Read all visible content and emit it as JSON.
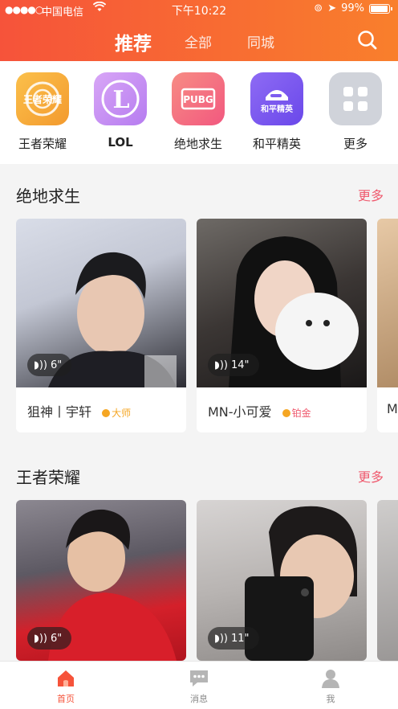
{
  "status": {
    "carrier": "中国电信",
    "time": "下午10:22",
    "battery": "99%"
  },
  "header": {
    "tab_active": "推荐",
    "tab_all": "全部",
    "tab_city": "同城"
  },
  "categories": [
    {
      "label": "王者荣耀",
      "icon_text": "王者荣耀",
      "icon": "honor-of-kings-icon",
      "color": "#f7a335"
    },
    {
      "label": "LOL",
      "icon_text": "L",
      "icon": "lol-icon",
      "color": "#c58cf0"
    },
    {
      "label": "绝地求生",
      "icon_text": "PUBG",
      "icon": "pubg-icon",
      "color": "#f36a8a"
    },
    {
      "label": "和平精英",
      "icon_text": "和平精英",
      "icon": "peace-elite-icon",
      "color": "#7d5cf0"
    },
    {
      "label": "更多",
      "icon_text": "",
      "icon": "more-grid-icon",
      "color": "#c9ccd3"
    }
  ],
  "sections": [
    {
      "title": "绝地求生",
      "more": "更多",
      "cards": [
        {
          "duration": "6\"",
          "name": "狙神丨宇轩",
          "rank": "大师"
        },
        {
          "duration": "14\"",
          "name": "MN-小可爱",
          "rank": "铂金"
        },
        {
          "duration": "",
          "name": "M",
          "rank": ""
        }
      ]
    },
    {
      "title": "王者荣耀",
      "more": "更多",
      "cards": [
        {
          "duration": "6\"",
          "name": "",
          "rank": ""
        },
        {
          "duration": "11\"",
          "name": "",
          "rank": ""
        }
      ]
    }
  ],
  "tabbar": {
    "home": "首页",
    "messages": "消息",
    "me": "我"
  },
  "colors": {
    "accent": "#f6533a",
    "more": "#ef5a6e",
    "rank_gold": "#f5a623"
  }
}
